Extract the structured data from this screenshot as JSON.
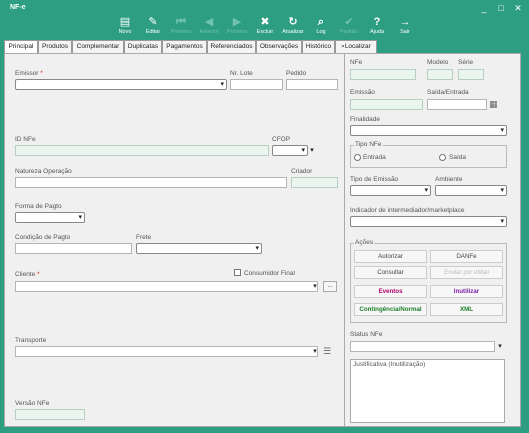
{
  "window": {
    "title": "NF-e",
    "minimize": "_",
    "restore": "□",
    "close": "✕"
  },
  "toolbar": [
    {
      "label": "Novo",
      "icon": "▤"
    },
    {
      "label": "Editar",
      "icon": "✎"
    },
    {
      "label": "Primeira",
      "icon": "⏮"
    },
    {
      "label": "Anterior",
      "icon": "◀"
    },
    {
      "label": "Próxima",
      "icon": "▶"
    },
    {
      "label": "Excluir",
      "icon": "✖"
    },
    {
      "label": "Atualizar",
      "icon": "↻"
    },
    {
      "label": "Log",
      "icon": "⌕"
    },
    {
      "label": "Padrão",
      "icon": "✔"
    },
    {
      "label": "Ajuda",
      "icon": "?"
    },
    {
      "label": "Sair",
      "icon": "→"
    }
  ],
  "tabs": [
    "Principal",
    "Produtos",
    "Complementar",
    "Duplicatas",
    "Pagamentos",
    "Referenciados",
    "Observações",
    "Histórico",
    "Localizar"
  ],
  "left": {
    "emissor": "Emissor",
    "nr_lote": "Nr. Lote",
    "pedido": "Pedido",
    "id_nfe": "ID NFe",
    "cfop": "CFOP",
    "natureza": "Natureza Operação",
    "criador": "Criador",
    "forma_pagto": "Forma de Pagto",
    "condicao_pagto": "Condição de Pagto",
    "frete": "Frete",
    "cliente": "Cliente",
    "consumidor_final": "Consumidor Final",
    "ellipsis": "...",
    "transporte": "Transporte",
    "versao_nfe": "Versão NFe",
    "required_mark": "*"
  },
  "right": {
    "nfe": "NFe",
    "modelo": "Modelo",
    "serie": "Série",
    "emissao": "Emissão",
    "saida_entrada": "Saída/Entrada",
    "finalidade": "Finalidade",
    "tipo_nfe": "Tipo NFe",
    "entrada": "Entrada",
    "saida": "Saída",
    "tipo_emissao": "Tipo de Emissão",
    "ambiente": "Ambiente",
    "indicador": "Indicador de intermediador/marketplace",
    "acoes": "Ações",
    "actions": [
      {
        "label": "Autorizar",
        "color": "#444",
        "disabled": false
      },
      {
        "label": "DANFe",
        "color": "#444",
        "disabled": false
      },
      {
        "label": "Consultar",
        "color": "#444",
        "disabled": false
      },
      {
        "label": "Enviar por eMail",
        "color": "#bbb",
        "disabled": true
      },
      {
        "label": "Eventos",
        "color": "#b0006a",
        "disabled": false
      },
      {
        "label": "Inutilizar",
        "color": "#7a1fa2",
        "disabled": false
      },
      {
        "label": "Contingência/Normal",
        "color": "#1e7d2a",
        "disabled": false
      },
      {
        "label": "XML",
        "color": "#1e7d2a",
        "disabled": false
      }
    ],
    "status_nfe": "Status NFe",
    "justificativa": "Justificativa (Inutilização)"
  }
}
